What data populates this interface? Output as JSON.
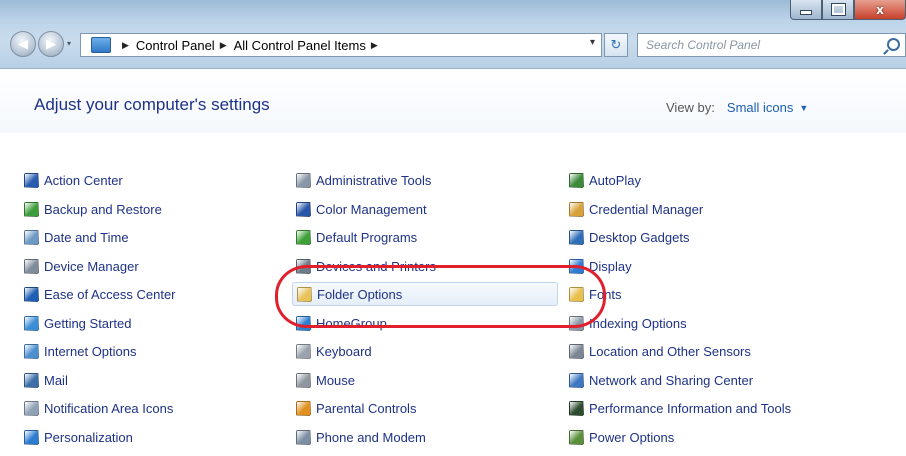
{
  "window": {
    "controls": [
      "minimize",
      "maximize",
      "close"
    ],
    "close_glyph": "x"
  },
  "nav": {
    "back_glyph": "◀",
    "forward_glyph": "▶",
    "history_glyph": "▾"
  },
  "address": {
    "crumbs": [
      "Control Panel",
      "All Control Panel Items"
    ],
    "separator": "▶",
    "dropdown_glyph": "▾",
    "refresh_glyph": "↻"
  },
  "search": {
    "placeholder": "Search Control Panel"
  },
  "header": {
    "title": "Adjust your computer's settings",
    "view_by_label": "View by:",
    "view_by_value": "Small icons",
    "view_by_arrow": "▼"
  },
  "items": {
    "col1": [
      {
        "label": "Action Center",
        "icon": "flag-icon",
        "color": "#2a5db0"
      },
      {
        "label": "Backup and Restore",
        "icon": "backup-icon",
        "color": "#3e9d3b"
      },
      {
        "label": "Date and Time",
        "icon": "clock-icon",
        "color": "#6e98c4"
      },
      {
        "label": "Device Manager",
        "icon": "device-manager-icon",
        "color": "#7f8c9a"
      },
      {
        "label": "Ease of Access Center",
        "icon": "ease-of-access-icon",
        "color": "#1f5fb3"
      },
      {
        "label": "Getting Started",
        "icon": "getting-started-icon",
        "color": "#3b8ed6"
      },
      {
        "label": "Internet Options",
        "icon": "internet-options-icon",
        "color": "#4b8fcf"
      },
      {
        "label": "Mail",
        "icon": "mail-icon",
        "color": "#3c6fa8"
      },
      {
        "label": "Notification Area Icons",
        "icon": "notification-area-icon",
        "color": "#8ea2b6"
      },
      {
        "label": "Personalization",
        "icon": "personalization-icon",
        "color": "#2d7cd0"
      }
    ],
    "col2": [
      {
        "label": "Administrative Tools",
        "icon": "administrative-tools-icon",
        "color": "#8897a7"
      },
      {
        "label": "Color Management",
        "icon": "color-management-icon",
        "color": "#2756a8"
      },
      {
        "label": "Default Programs",
        "icon": "default-programs-icon",
        "color": "#3fa03a"
      },
      {
        "label": "Devices and Printers",
        "icon": "printer-icon",
        "color": "#6d7b8a"
      },
      {
        "label": "Folder Options",
        "icon": "folder-options-icon",
        "color": "#e7c35a",
        "selected": true
      },
      {
        "label": "HomeGroup",
        "icon": "homegroup-icon",
        "color": "#2f7fd0"
      },
      {
        "label": "Keyboard",
        "icon": "keyboard-icon",
        "color": "#9aa3ad"
      },
      {
        "label": "Mouse",
        "icon": "mouse-icon",
        "color": "#8e969f"
      },
      {
        "label": "Parental Controls",
        "icon": "parental-controls-icon",
        "color": "#e0901f"
      },
      {
        "label": "Phone and Modem",
        "icon": "phone-modem-icon",
        "color": "#7b8ea3"
      }
    ],
    "col3": [
      {
        "label": "AutoPlay",
        "icon": "autoplay-icon",
        "color": "#3d8a3a"
      },
      {
        "label": "Credential Manager",
        "icon": "credential-manager-icon",
        "color": "#d8a23a"
      },
      {
        "label": "Desktop Gadgets",
        "icon": "desktop-gadgets-icon",
        "color": "#2f6fb8"
      },
      {
        "label": "Display",
        "icon": "display-icon",
        "color": "#2f7cd4"
      },
      {
        "label": "Fonts",
        "icon": "fonts-icon",
        "color": "#e8c04e"
      },
      {
        "label": "Indexing Options",
        "icon": "indexing-options-icon",
        "color": "#8b98a8"
      },
      {
        "label": "Location and Other Sensors",
        "icon": "location-sensors-icon",
        "color": "#7d8794"
      },
      {
        "label": "Network and Sharing Center",
        "icon": "network-sharing-icon",
        "color": "#3e78c2"
      },
      {
        "label": "Performance Information and Tools",
        "icon": "performance-icon",
        "color": "#2d4b2f"
      },
      {
        "label": "Power Options",
        "icon": "power-options-icon",
        "color": "#5a8f3c"
      }
    ]
  },
  "annotation": {
    "color": "#e0202c",
    "target": "Folder Options"
  }
}
